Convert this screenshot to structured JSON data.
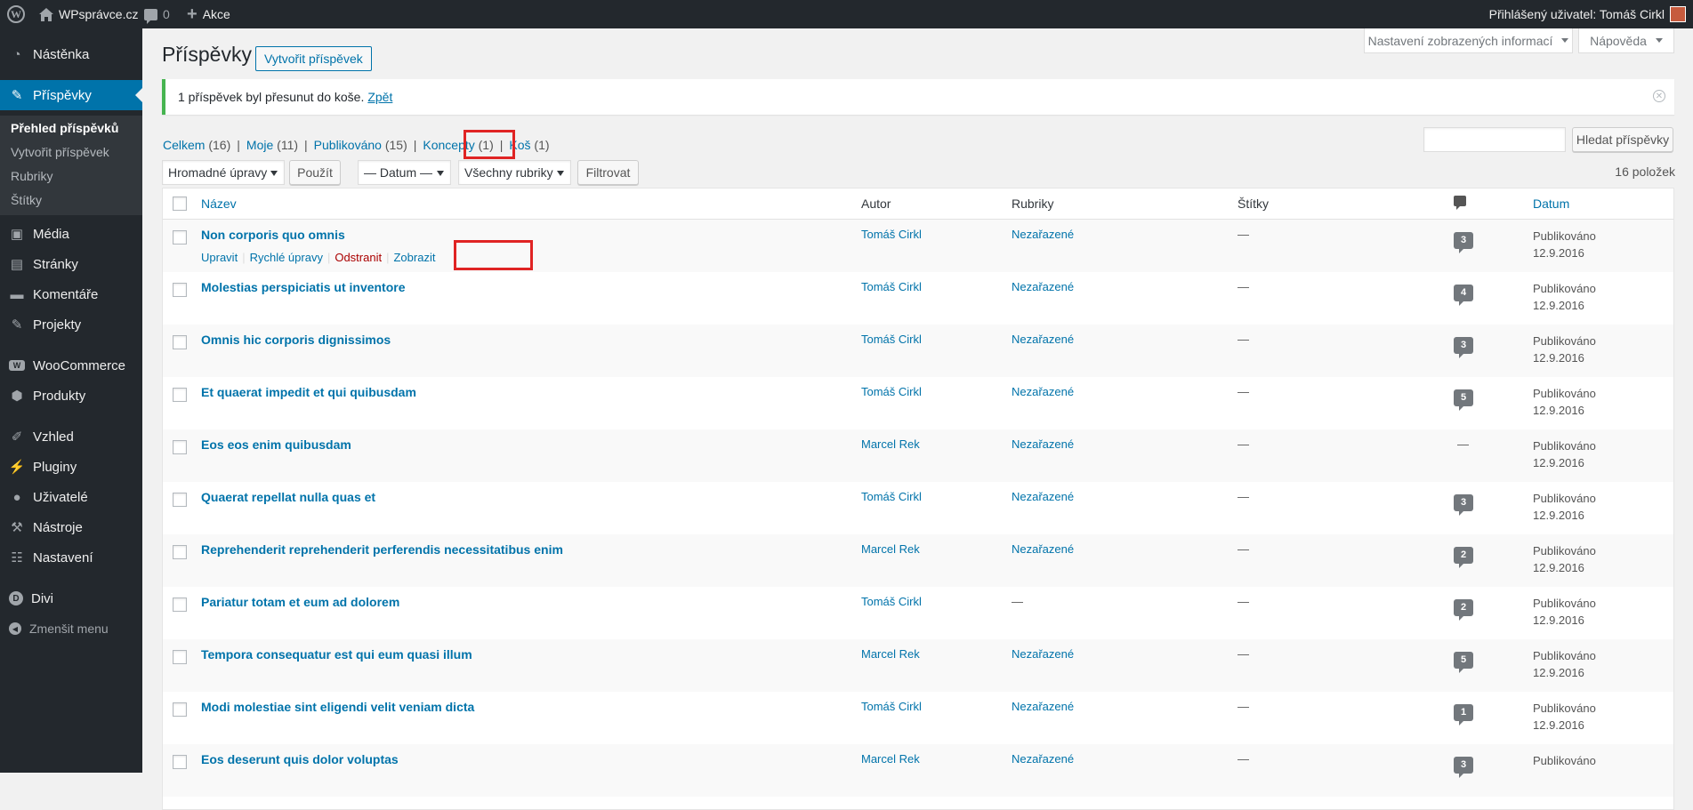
{
  "adminbar": {
    "site_name": "WPsprávce.cz",
    "comments_count": "0",
    "new_label": "Akce",
    "account_label": "Přihlášený uživatel: Tomáš Cirkl"
  },
  "menu": {
    "dashboard": "Nástěnka",
    "posts": "Příspěvky",
    "posts_sub": [
      "Přehled příspěvků",
      "Vytvořit příspěvek",
      "Rubriky",
      "Štítky"
    ],
    "media": "Média",
    "pages": "Stránky",
    "comments": "Komentáře",
    "projects": "Projekty",
    "woocommerce": "WooCommerce",
    "products": "Produkty",
    "appearance": "Vzhled",
    "plugins": "Pluginy",
    "users": "Uživatelé",
    "tools": "Nástroje",
    "settings": "Nastavení",
    "divi": "Divi",
    "collapse": "Zmenšit menu"
  },
  "screen_options": "Nastavení zobrazených informací",
  "help": "Nápověda",
  "page_title": "Příspěvky",
  "add_new": "Vytvořit příspěvek",
  "notice": {
    "message": "1 příspěvek byl přesunut do koše.",
    "undo": "Zpět"
  },
  "views": [
    {
      "label": "Celkem",
      "count": "(16)"
    },
    {
      "label": "Moje",
      "count": "(11)"
    },
    {
      "label": "Publikováno",
      "count": "(15)"
    },
    {
      "label": "Koncepty",
      "count": "(1)"
    },
    {
      "label": "Koš",
      "count": "(1)"
    }
  ],
  "search_button": "Hledat příspěvky",
  "filters": {
    "bulk": "Hromadné úpravy",
    "apply": "Použít",
    "date": "— Datum —",
    "categories": "Všechny rubriky",
    "filter": "Filtrovat"
  },
  "items_count": "16 položek",
  "columns": {
    "title": "Název",
    "author": "Autor",
    "categories": "Rubriky",
    "tags": "Štítky",
    "date": "Datum"
  },
  "row_actions": {
    "edit": "Upravit",
    "quick_edit": "Rychlé úpravy",
    "trash": "Odstranit",
    "view": "Zobrazit"
  },
  "posts": [
    {
      "title": "Non corporis quo omnis",
      "author": "Tomáš Cirkl",
      "category": "Nezařazené",
      "tags": "—",
      "comments": "3",
      "status": "Publikováno",
      "date": "12.9.2016"
    },
    {
      "title": "Molestias perspiciatis ut inventore",
      "author": "Tomáš Cirkl",
      "category": "Nezařazené",
      "tags": "—",
      "comments": "4",
      "status": "Publikováno",
      "date": "12.9.2016"
    },
    {
      "title": "Omnis hic corporis dignissimos",
      "author": "Tomáš Cirkl",
      "category": "Nezařazené",
      "tags": "—",
      "comments": "3",
      "status": "Publikováno",
      "date": "12.9.2016"
    },
    {
      "title": "Et quaerat impedit et qui quibusdam",
      "author": "Tomáš Cirkl",
      "category": "Nezařazené",
      "tags": "—",
      "comments": "5",
      "status": "Publikováno",
      "date": "12.9.2016"
    },
    {
      "title": "Eos eos enim quibusdam",
      "author": "Marcel Rek",
      "category": "Nezařazené",
      "tags": "—",
      "comments": "—",
      "status": "Publikováno",
      "date": "12.9.2016"
    },
    {
      "title": "Quaerat repellat nulla quas et",
      "author": "Tomáš Cirkl",
      "category": "Nezařazené",
      "tags": "—",
      "comments": "3",
      "status": "Publikováno",
      "date": "12.9.2016"
    },
    {
      "title": "Reprehenderit reprehenderit perferendis necessitatibus enim",
      "author": "Marcel Rek",
      "category": "Nezařazené",
      "tags": "—",
      "comments": "2",
      "status": "Publikováno",
      "date": "12.9.2016"
    },
    {
      "title": "Pariatur totam et eum ad dolorem",
      "author": "Tomáš Cirkl",
      "category": "—",
      "tags": "—",
      "comments": "2",
      "status": "Publikováno",
      "date": "12.9.2016"
    },
    {
      "title": "Tempora consequatur est qui eum quasi illum",
      "author": "Marcel Rek",
      "category": "Nezařazené",
      "tags": "—",
      "comments": "5",
      "status": "Publikováno",
      "date": "12.9.2016"
    },
    {
      "title": "Modi molestiae sint eligendi velit veniam dicta",
      "author": "Tomáš Cirkl",
      "category": "Nezařazené",
      "tags": "—",
      "comments": "1",
      "status": "Publikováno",
      "date": "12.9.2016"
    },
    {
      "title": "Eos deserunt quis dolor voluptas",
      "author": "Marcel Rek",
      "category": "Nezařazené",
      "tags": "—",
      "comments": "3",
      "status": "Publikováno",
      "date": ""
    }
  ]
}
